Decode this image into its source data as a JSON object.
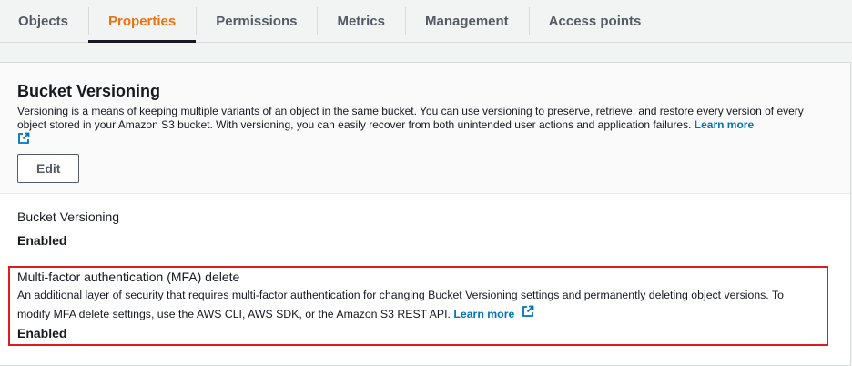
{
  "tabs": [
    {
      "label": "Objects"
    },
    {
      "label": "Properties"
    },
    {
      "label": "Permissions"
    },
    {
      "label": "Metrics"
    },
    {
      "label": "Management"
    },
    {
      "label": "Access points"
    }
  ],
  "bucket_versioning": {
    "title": "Bucket Versioning",
    "description": "Versioning is a means of keeping multiple variants of an object in the same bucket. You can use versioning to preserve, retrieve, and restore every version of every object stored in your Amazon S3 bucket. With versioning, you can easily recover from both unintended user actions and application failures.",
    "learn_more": "Learn more",
    "edit_label": "Edit"
  },
  "versioning_field": {
    "label": "Bucket Versioning",
    "value": "Enabled"
  },
  "mfa_field": {
    "label": "Multi-factor authentication (MFA) delete",
    "description": "An additional layer of security that requires multi-factor authentication for changing Bucket Versioning settings and permanently deleting object versions. To modify MFA delete settings, use the AWS CLI, AWS SDK, or the Amazon S3 REST API.",
    "learn_more": "Learn more",
    "value": "Enabled"
  },
  "colors": {
    "accent_orange": "#ec7211",
    "link_blue": "#0073bb",
    "highlight_red": "#e01b1b"
  },
  "icons": [
    "external-link-icon"
  ]
}
